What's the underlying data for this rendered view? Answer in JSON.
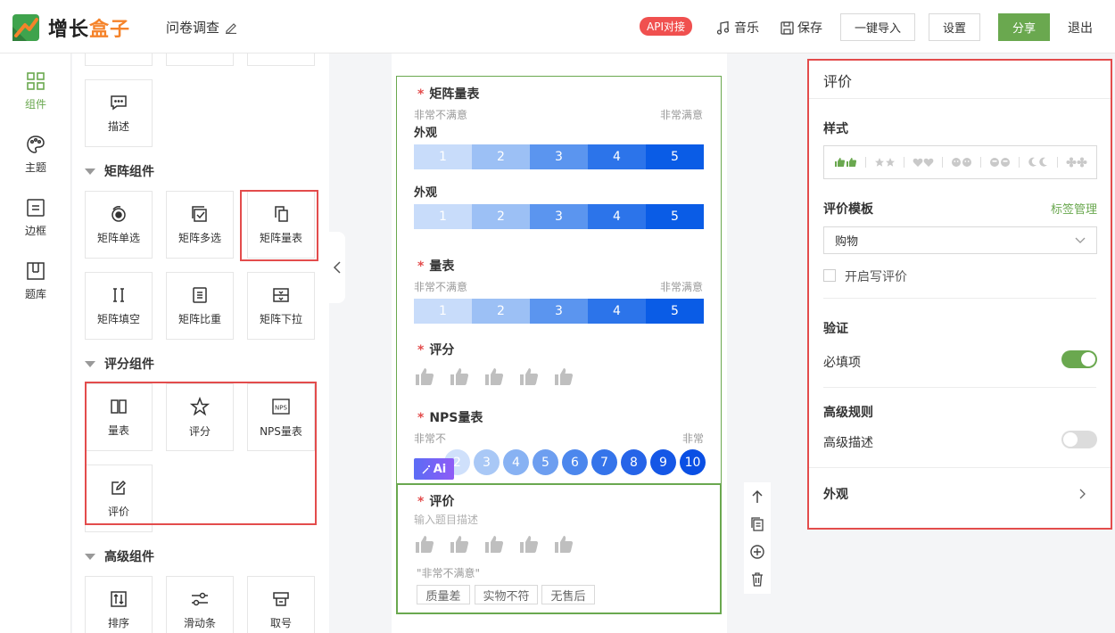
{
  "header": {
    "logo_part1": "增长",
    "logo_part2": "盒子",
    "survey_title": "问卷调查",
    "api_badge": "API对接",
    "music": "音乐",
    "save": "保存",
    "import": "一键导入",
    "settings": "设置",
    "share": "分享",
    "exit": "退出"
  },
  "nav": [
    {
      "label": "组件",
      "icon": "grid-icon"
    },
    {
      "label": "主题",
      "icon": "palette-icon"
    },
    {
      "label": "边框",
      "icon": "border-icon"
    },
    {
      "label": "题库",
      "icon": "library-icon"
    }
  ],
  "panel": {
    "desc": "描述",
    "matrix_section": "矩阵组件",
    "matrix_items": [
      "矩阵单选",
      "矩阵多选",
      "矩阵量表",
      "矩阵填空",
      "矩阵比重",
      "矩阵下拉"
    ],
    "rating_section": "评分组件",
    "rating_items": [
      "量表",
      "评分",
      "NPS量表",
      "评价"
    ],
    "advanced_section": "高级组件",
    "advanced_items": [
      "排序",
      "滑动条",
      "取号"
    ]
  },
  "canvas": {
    "q1_title": "矩阵量表",
    "low_label": "非常不满意",
    "high_label": "非常满意",
    "row_label": "外观",
    "scale_values": [
      "1",
      "2",
      "3",
      "4",
      "5"
    ],
    "q2_title": "量表",
    "q3_title": "评分",
    "q4_title": "NPS量表",
    "nps_low": "非常不",
    "nps_high": "非常",
    "nps_values": [
      "2",
      "3",
      "4",
      "5",
      "6",
      "7",
      "8",
      "9",
      "10"
    ],
    "ai_badge": "Ai",
    "q5_title": "评价",
    "q5_placeholder": "输入题目描述",
    "q5_selected_label": "\"非常不满意\"",
    "tags": [
      "质量差",
      "实物不符",
      "无售后"
    ]
  },
  "right": {
    "title": "评价",
    "style_label": "样式",
    "template_label": "评价模板",
    "tag_manage": "标签管理",
    "template_value": "购物",
    "enable_review": "开启写评价",
    "validation": "验证",
    "required": "必填项",
    "required_on": true,
    "advanced": "高级规则",
    "advanced_desc": "高级描述",
    "advanced_on": false,
    "appearance": "外观"
  },
  "colors": {
    "accent": "#6aa84f",
    "highlight": "#e34c4c",
    "scale": [
      "#c8dcfa",
      "#9cc0f5",
      "#5b95ef",
      "#2c74ea",
      "#0a5ce6"
    ],
    "nps": [
      "#cfe0fb",
      "#a9c8f6",
      "#88b2f3",
      "#6d9ef0",
      "#4c87ed",
      "#3574ea",
      "#2664e8",
      "#1557e6",
      "#0a4fe4"
    ]
  }
}
